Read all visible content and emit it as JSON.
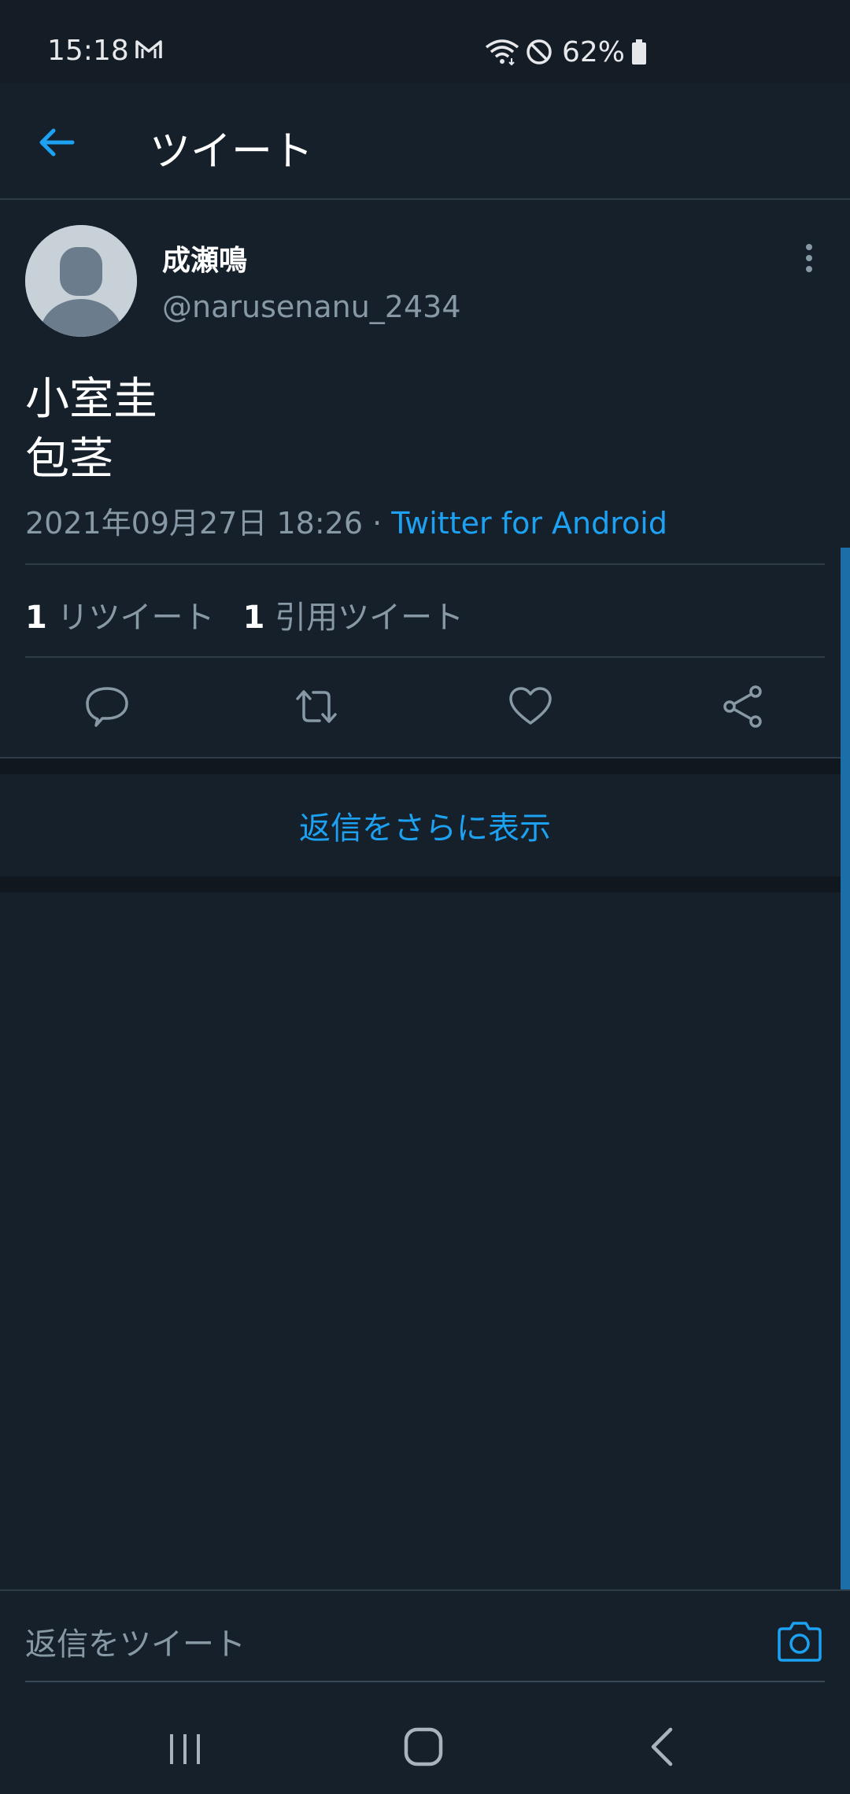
{
  "status_bar": {
    "time": "15:18",
    "battery": "62%",
    "icons": [
      "gmail-icon",
      "wifi-icon",
      "do-not-disturb-icon",
      "battery-icon"
    ]
  },
  "header": {
    "title": "ツイート",
    "back_icon": "back-arrow-icon"
  },
  "tweet": {
    "author_name": "成瀬鳴",
    "author_handle": "@narusenanu_2434",
    "text_lines": [
      "小室圭",
      "包茎"
    ],
    "timestamp": "2021年09月27日 18:26 · ",
    "source": "Twitter for Android",
    "retweet_count": "1",
    "retweet_label": " リツイート",
    "quote_count": "1",
    "quote_label": " 引用ツイート"
  },
  "actions": [
    "reply-icon",
    "retweet-icon",
    "like-icon",
    "share-icon"
  ],
  "more_replies": "返信をさらに表示",
  "reply_composer": {
    "placeholder": "返信をツイート"
  },
  "colors": {
    "background": "#15202b",
    "accent": "#1da1f2",
    "secondary_text": "#8899a6",
    "divider": "#2f3b47"
  }
}
